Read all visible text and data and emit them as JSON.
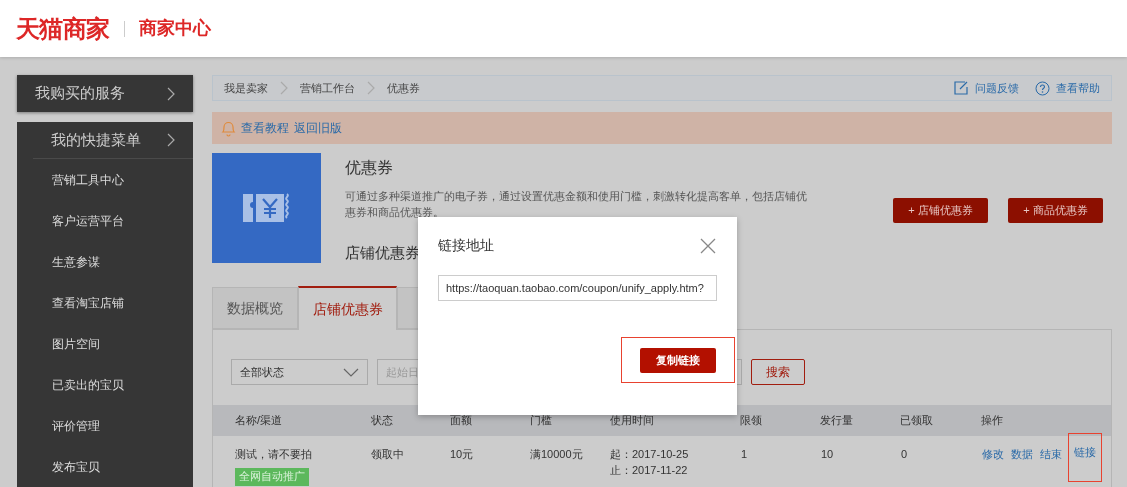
{
  "header": {
    "logo": "天猫商家",
    "subtitle": "商家中心"
  },
  "sidebar": {
    "services": {
      "label": "我购买的服务"
    },
    "quick_menu": {
      "label": "我的快捷菜单",
      "items": [
        {
          "label": "营销工具中心"
        },
        {
          "label": "客户运营平台"
        },
        {
          "label": "生意参谋"
        },
        {
          "label": "查看淘宝店铺"
        },
        {
          "label": "图片空间"
        },
        {
          "label": "已卖出的宝贝"
        },
        {
          "label": "评价管理"
        },
        {
          "label": "发布宝贝"
        }
      ]
    }
  },
  "breadcrumb": [
    "我是卖家",
    "营销工作台",
    "优惠券"
  ],
  "help_links": [
    {
      "kind": "feedback",
      "label": "问题反馈"
    },
    {
      "kind": "help",
      "label": "查看帮助"
    }
  ],
  "notice": {
    "links": [
      "查看教程",
      "返回旧版"
    ]
  },
  "intro": {
    "title": "优惠券",
    "description": "可通过多种渠道推广的电子券，通过设置优惠金额和使用门槛，刺激转化提高客单，包括店铺优惠券和商品优惠券。",
    "subheading": "店铺优惠券"
  },
  "create_buttons": [
    "+ 店铺优惠券",
    "+ 商品优惠券"
  ],
  "tabs": [
    {
      "label": "数据概览",
      "selected": false
    },
    {
      "label": "店铺优惠券",
      "selected": true
    },
    {
      "selected": false
    }
  ],
  "filters": {
    "status": "全部状态",
    "start_date_placeholder": "起始日",
    "search": "搜索"
  },
  "table": {
    "columns": [
      "名称/渠道",
      "状态",
      "面额",
      "门槛",
      "使用时间",
      "限领",
      "发行量",
      "已领取",
      "操作"
    ],
    "rows": [
      {
        "name": "测试，请不要拍",
        "tag": "全网自动推广",
        "status": "领取中",
        "amount": "10元",
        "threshold": "满10000元",
        "start": "起：2017-10-25",
        "end": "止：2017-11-22",
        "limit": "1",
        "issued": "10",
        "claimed": "0",
        "actions": [
          {
            "label": "修改",
            "highlighted": false
          },
          {
            "label": "数据",
            "highlighted": false
          },
          {
            "label": "结束",
            "highlighted": false
          },
          {
            "label": "链接",
            "highlighted": true
          }
        ]
      }
    ]
  },
  "dialog": {
    "title": "链接地址",
    "url": "https://taoquan.taobao.com/coupon/unify_apply.htm?",
    "button": {
      "label": "复制链接",
      "highlighted": true
    }
  }
}
